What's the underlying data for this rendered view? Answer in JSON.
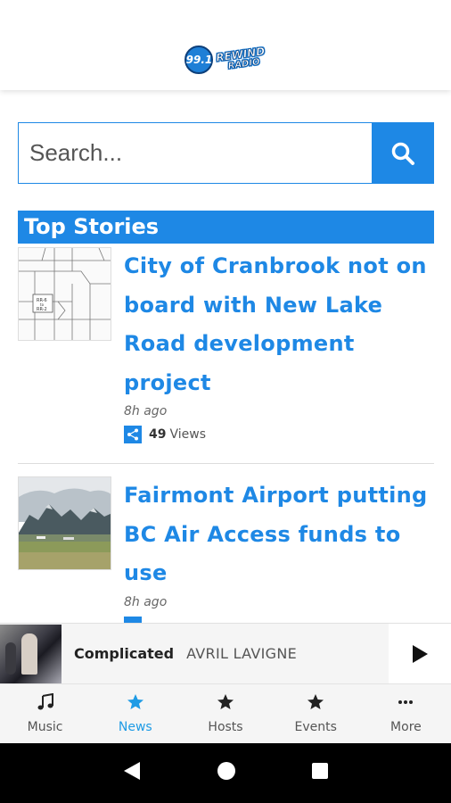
{
  "header": {
    "logo_number": "99.1",
    "logo_word1": "REWIND",
    "logo_word2": "RADIO"
  },
  "search": {
    "placeholder": "Search...",
    "button_icon": "search-icon"
  },
  "section": {
    "title": "Top Stories"
  },
  "stories": [
    {
      "title": "City of Cranbrook not on board with New Lake Road development project",
      "time": "8h ago",
      "views_count": "49",
      "views_label": "Views",
      "thumb_icon": "map-thumbnail",
      "share_icon": "share-icon"
    },
    {
      "title": "Fairmont Airport putting BC Air Access funds to use",
      "time": "8h ago",
      "thumb_icon": "mountain-airport-thumbnail"
    }
  ],
  "player": {
    "track": "Complicated",
    "artist": "AVRIL LAVIGNE",
    "play_icon": "play-icon"
  },
  "nav": {
    "items": [
      {
        "label": "Music",
        "icon": "music-note-icon"
      },
      {
        "label": "News",
        "icon": "star-icon"
      },
      {
        "label": "Hosts",
        "icon": "star-icon"
      },
      {
        "label": "Events",
        "icon": "star-icon"
      },
      {
        "label": "More",
        "icon": "more-dots-icon"
      }
    ],
    "active_index": 1
  },
  "system_nav": [
    "back-icon",
    "home-icon",
    "recents-icon"
  ],
  "colors": {
    "accent": "#1e88e5",
    "active_tab": "#1e9be5",
    "text_dark": "#222222"
  }
}
